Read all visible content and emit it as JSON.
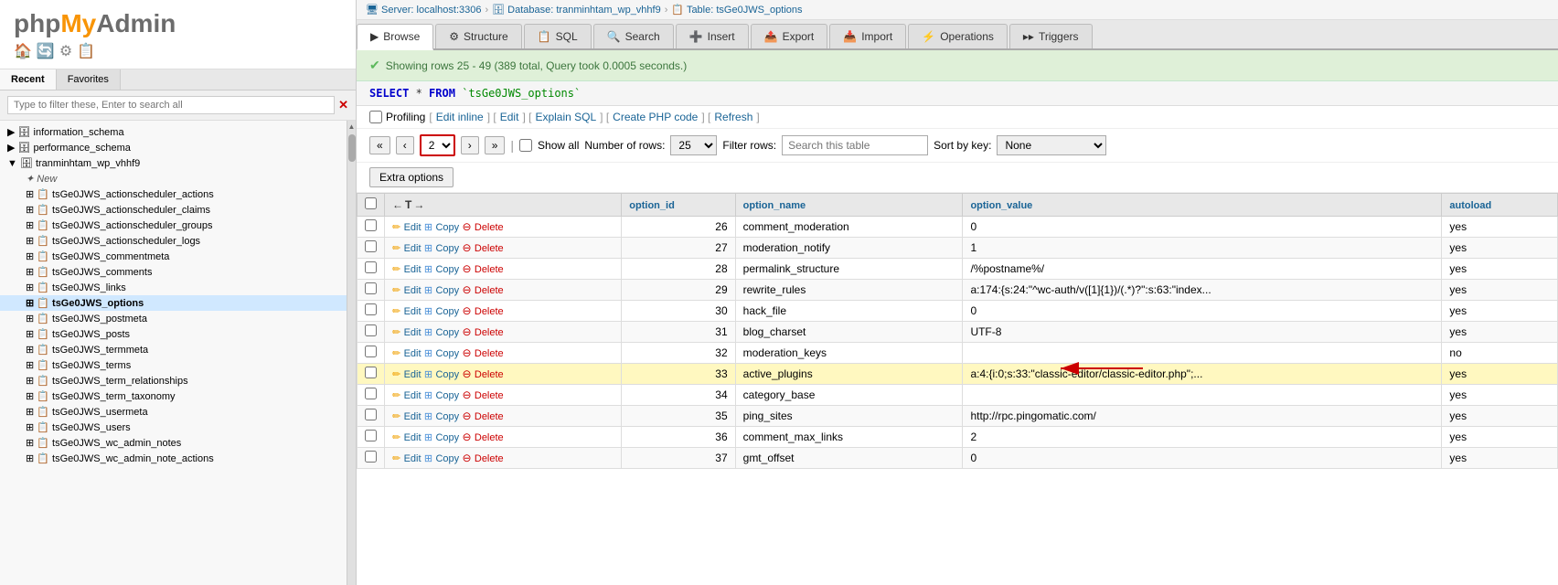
{
  "logo": {
    "php": "php",
    "my": "My",
    "admin": "Admin"
  },
  "logo_icons": [
    "🏠",
    "🔄",
    "⚙",
    "📋"
  ],
  "sidebar_tabs": [
    "Recent",
    "Favorites"
  ],
  "filter_placeholder": "Type to filter these, Enter to search all",
  "db_tree": [
    {
      "label": "information_schema",
      "type": "db",
      "expanded": false,
      "indent": 0
    },
    {
      "label": "performance_schema",
      "type": "db",
      "expanded": false,
      "indent": 0
    },
    {
      "label": "tranminhtam_wp_vhhf9",
      "type": "db",
      "expanded": true,
      "indent": 0
    },
    {
      "label": "New",
      "type": "new",
      "indent": 1
    },
    {
      "label": "tsGe0JWS_actionscheduler_actions",
      "type": "table",
      "indent": 1
    },
    {
      "label": "tsGe0JWS_actionscheduler_claims",
      "type": "table",
      "indent": 1
    },
    {
      "label": "tsGe0JWS_actionscheduler_groups",
      "type": "table",
      "indent": 1
    },
    {
      "label": "tsGe0JWS_actionscheduler_logs",
      "type": "table",
      "indent": 1
    },
    {
      "label": "tsGe0JWS_commentmeta",
      "type": "table",
      "indent": 1
    },
    {
      "label": "tsGe0JWS_comments",
      "type": "table",
      "indent": 1
    },
    {
      "label": "tsGe0JWS_links",
      "type": "table",
      "indent": 1
    },
    {
      "label": "tsGe0JWS_options",
      "type": "table",
      "active": true,
      "indent": 1
    },
    {
      "label": "tsGe0JWS_postmeta",
      "type": "table",
      "indent": 1
    },
    {
      "label": "tsGe0JWS_posts",
      "type": "table",
      "indent": 1
    },
    {
      "label": "tsGe0JWS_termmeta",
      "type": "table",
      "indent": 1
    },
    {
      "label": "tsGe0JWS_terms",
      "type": "table",
      "indent": 1
    },
    {
      "label": "tsGe0JWS_term_relationships",
      "type": "table",
      "indent": 1
    },
    {
      "label": "tsGe0JWS_term_taxonomy",
      "type": "table",
      "indent": 1
    },
    {
      "label": "tsGe0JWS_usermeta",
      "type": "table",
      "indent": 1
    },
    {
      "label": "tsGe0JWS_users",
      "type": "table",
      "indent": 1
    },
    {
      "label": "tsGe0JWS_wc_admin_notes",
      "type": "table",
      "indent": 1
    },
    {
      "label": "tsGe0JWS_wc_admin_note_actions",
      "type": "table",
      "indent": 1
    }
  ],
  "breadcrumb": {
    "server": "Server: localhost:3306",
    "database": "Database: tranminhtam_wp_vhhf9",
    "table": "Table: tsGe0JWS_options"
  },
  "tabs": [
    {
      "label": "Browse",
      "icon": "▶"
    },
    {
      "label": "Structure",
      "icon": "⚙"
    },
    {
      "label": "SQL",
      "icon": "📋"
    },
    {
      "label": "Search",
      "icon": "🔍"
    },
    {
      "label": "Insert",
      "icon": "➕"
    },
    {
      "label": "Export",
      "icon": "📤"
    },
    {
      "label": "Import",
      "icon": "📥"
    },
    {
      "label": "Operations",
      "icon": "⚡"
    },
    {
      "label": "Triggers",
      "icon": "▸▸"
    }
  ],
  "active_tab": "Browse",
  "success_message": "Showing rows 25 - 49 (389 total, Query took 0.0005 seconds.)",
  "sql_query": "SELECT * FROM `tsGe0JWS_options`",
  "profiling_label": "Profiling",
  "profiling_links": [
    "Edit inline",
    "Edit",
    "Explain SQL",
    "Create PHP code",
    "Refresh"
  ],
  "pagination": {
    "first_label": "<<",
    "prev_label": "<",
    "current_page": "2",
    "next_label": ">",
    "last_label": ">>",
    "show_all_label": "Show all",
    "number_of_rows_label": "Number of rows:",
    "rows_value": "25",
    "filter_rows_label": "Filter rows:",
    "filter_placeholder": "Search this table",
    "sort_by_label": "Sort by key:",
    "sort_value": "None"
  },
  "extra_options_label": "Extra options",
  "table_headers": [
    {
      "label": "→T←",
      "sortable": true
    },
    {
      "label": "option_id",
      "sortable": true
    },
    {
      "label": "option_name",
      "sortable": true
    },
    {
      "label": "option_value",
      "sortable": true
    },
    {
      "label": "autoload",
      "sortable": true
    }
  ],
  "rows": [
    {
      "id": 26,
      "option_name": "comment_moderation",
      "option_value": "0",
      "autoload": "yes",
      "highlighted": false,
      "arrow": false
    },
    {
      "id": 27,
      "option_name": "moderation_notify",
      "option_value": "1",
      "autoload": "yes",
      "highlighted": false,
      "arrow": false
    },
    {
      "id": 28,
      "option_name": "permalink_structure",
      "option_value": "/%postname%/",
      "autoload": "yes",
      "highlighted": false,
      "arrow": false
    },
    {
      "id": 29,
      "option_name": "rewrite_rules",
      "option_value": "a:174:{s:24:\"^wc-auth/v([1]{1})/(.*)?\":s:63:\"index...",
      "autoload": "yes",
      "highlighted": false,
      "arrow": false
    },
    {
      "id": 30,
      "option_name": "hack_file",
      "option_value": "0",
      "autoload": "yes",
      "highlighted": false,
      "arrow": false
    },
    {
      "id": 31,
      "option_name": "blog_charset",
      "option_value": "UTF-8",
      "autoload": "yes",
      "highlighted": false,
      "arrow": false
    },
    {
      "id": 32,
      "option_name": "moderation_keys",
      "option_value": "",
      "autoload": "no",
      "highlighted": false,
      "arrow": false
    },
    {
      "id": 33,
      "option_name": "active_plugins",
      "option_value": "a:4:{i:0;s:33:\"classic-editor/classic-editor.php\";...",
      "autoload": "yes",
      "highlighted": true,
      "arrow": true
    },
    {
      "id": 34,
      "option_name": "category_base",
      "option_value": "",
      "autoload": "yes",
      "highlighted": false,
      "arrow": false
    },
    {
      "id": 35,
      "option_name": "ping_sites",
      "option_value": "http://rpc.pingomatic.com/",
      "autoload": "yes",
      "highlighted": false,
      "arrow": false
    },
    {
      "id": 36,
      "option_name": "comment_max_links",
      "option_value": "2",
      "autoload": "yes",
      "highlighted": false,
      "arrow": false
    },
    {
      "id": 37,
      "option_name": "gmt_offset",
      "option_value": "0",
      "autoload": "yes",
      "highlighted": false,
      "arrow": false
    }
  ],
  "action_labels": {
    "edit": "Edit",
    "copy": "Copy",
    "delete": "Delete"
  }
}
